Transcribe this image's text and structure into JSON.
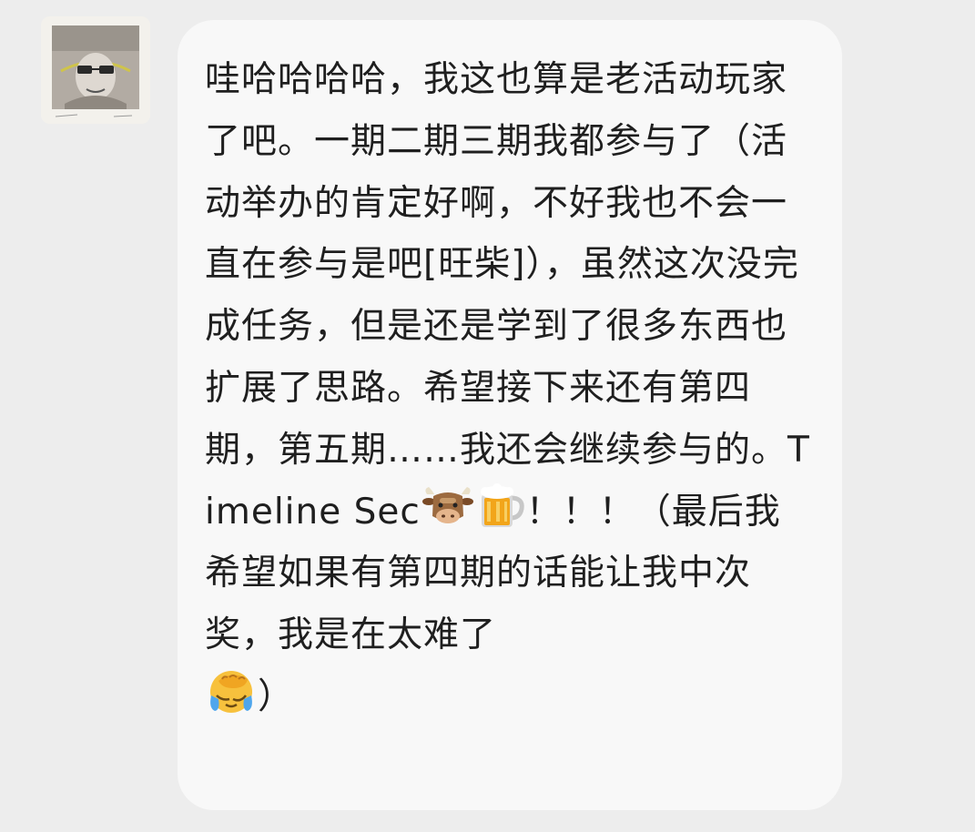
{
  "message": {
    "segments": [
      "哇哈哈哈哈，我这也算是老活动玩家了吧。一期二期三期我都参与了（活动举办的肯定好啊，不好我也不会一直在参与是吧[旺柴]），虽然这次没完成任务，但是还是学到了很多东西也扩展了思路。希望接下来还有第四期，第五期……我还会继续参与的。Timeline Sec",
      "！！！（最后我希望如果有第四期的话能让我中次奖，我是在太难了",
      "）"
    ],
    "emojis": {
      "first": "cow-face",
      "second": "beer-mug",
      "third": "face-palm-crying"
    }
  },
  "colors": {
    "background": "#ededed",
    "bubble": "#f8f8f8",
    "text": "#1f1f1f"
  }
}
